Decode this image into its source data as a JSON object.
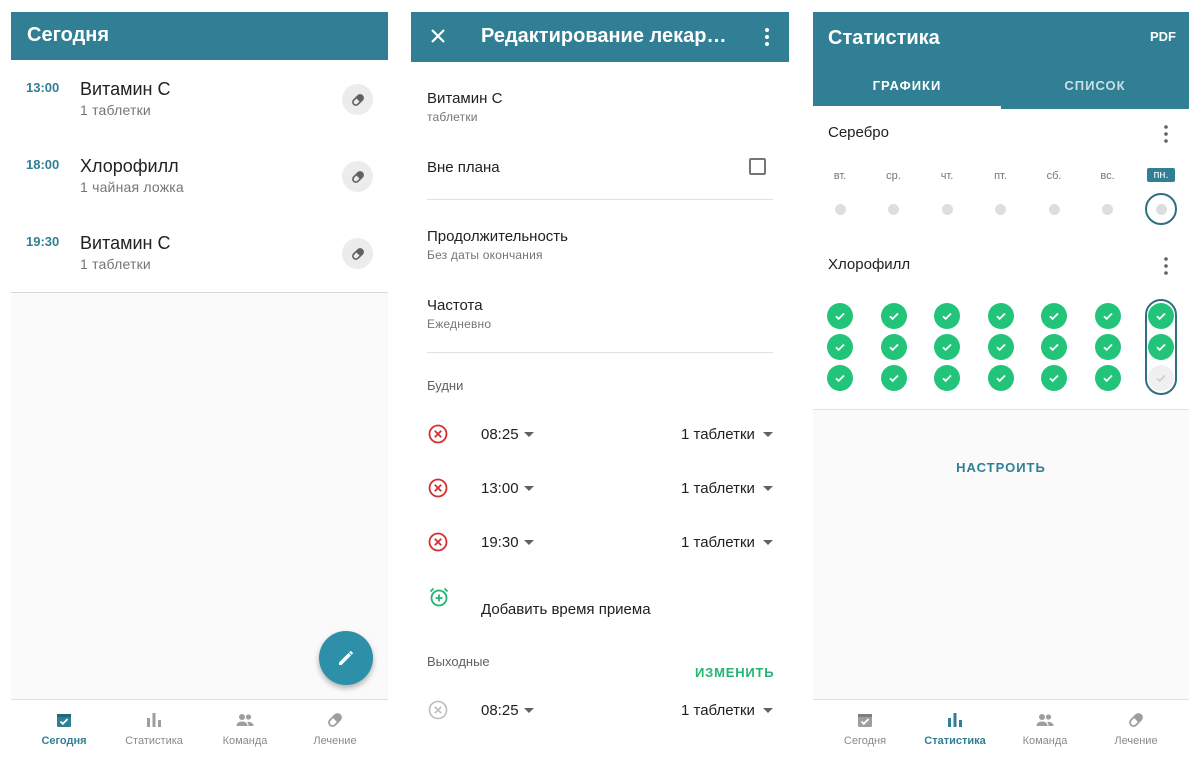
{
  "colors": {
    "primary": "#307f94",
    "fab": "#2e8fa8",
    "success": "#22c47a",
    "danger": "#d32f2f",
    "accent_green": "#22b573"
  },
  "screen_today": {
    "title": "Сегодня",
    "doses": [
      {
        "time": "13:00",
        "name": "Витамин С",
        "qty": "1 таблетки"
      },
      {
        "time": "18:00",
        "name": "Хлорофилл",
        "qty": "1 чайная ложка"
      },
      {
        "time": "19:30",
        "name": "Витамин С",
        "qty": "1 таблетки"
      }
    ],
    "fab_icon": "pencil-icon"
  },
  "bottom_nav": [
    {
      "label": "Сегодня",
      "icon": "calendar-check-icon"
    },
    {
      "label": "Статистика",
      "icon": "bar-chart-icon"
    },
    {
      "label": "Команда",
      "icon": "people-icon"
    },
    {
      "label": "Лечение",
      "icon": "pill-icon"
    }
  ],
  "screen_edit": {
    "title": "Редактирование лекарства",
    "medicine": {
      "name": "Витамин С",
      "form": "таблетки"
    },
    "unplanned_label": "Вне плана",
    "unplanned_checked": false,
    "duration": {
      "label": "Продолжительность",
      "value": "Без даты окончания"
    },
    "frequency": {
      "label": "Частота",
      "value": "Ежедневно"
    },
    "weekdays_label": "Будни",
    "weekday_times": [
      {
        "time": "08:25",
        "qty": "1 таблетки"
      },
      {
        "time": "13:00",
        "qty": "1 таблетки"
      },
      {
        "time": "19:30",
        "qty": "1 таблетки"
      }
    ],
    "add_time_label": "Добавить время приема",
    "weekend_label": "Выходные",
    "change_label": "ИЗМЕНИТЬ",
    "weekend_times": [
      {
        "time": "08:25",
        "qty": "1 таблетки"
      }
    ]
  },
  "screen_stats": {
    "title": "Статистика",
    "pdf_label": "PDF",
    "tabs": [
      "ГРАФИКИ",
      "СПИСОК"
    ],
    "active_tab": 0,
    "days": [
      "вт.",
      "ср.",
      "чт.",
      "пт.",
      "сб.",
      "вс.",
      "пн."
    ],
    "today_index": 6,
    "medicines": [
      {
        "name": "Серебро",
        "doses_per_day": 1,
        "taken": [
          [
            0
          ],
          [
            0
          ],
          [
            0
          ],
          [
            0
          ],
          [
            0
          ],
          [
            0
          ],
          [
            0
          ]
        ]
      },
      {
        "name": "Хлорофилл",
        "doses_per_day": 3,
        "taken": [
          [
            1,
            1,
            1
          ],
          [
            1,
            1,
            1
          ],
          [
            1,
            1,
            1
          ],
          [
            1,
            1,
            1
          ],
          [
            1,
            1,
            1
          ],
          [
            1,
            1,
            1
          ],
          [
            1,
            1,
            0
          ]
        ]
      }
    ],
    "setup_label": "НАСТРОИТЬ"
  }
}
